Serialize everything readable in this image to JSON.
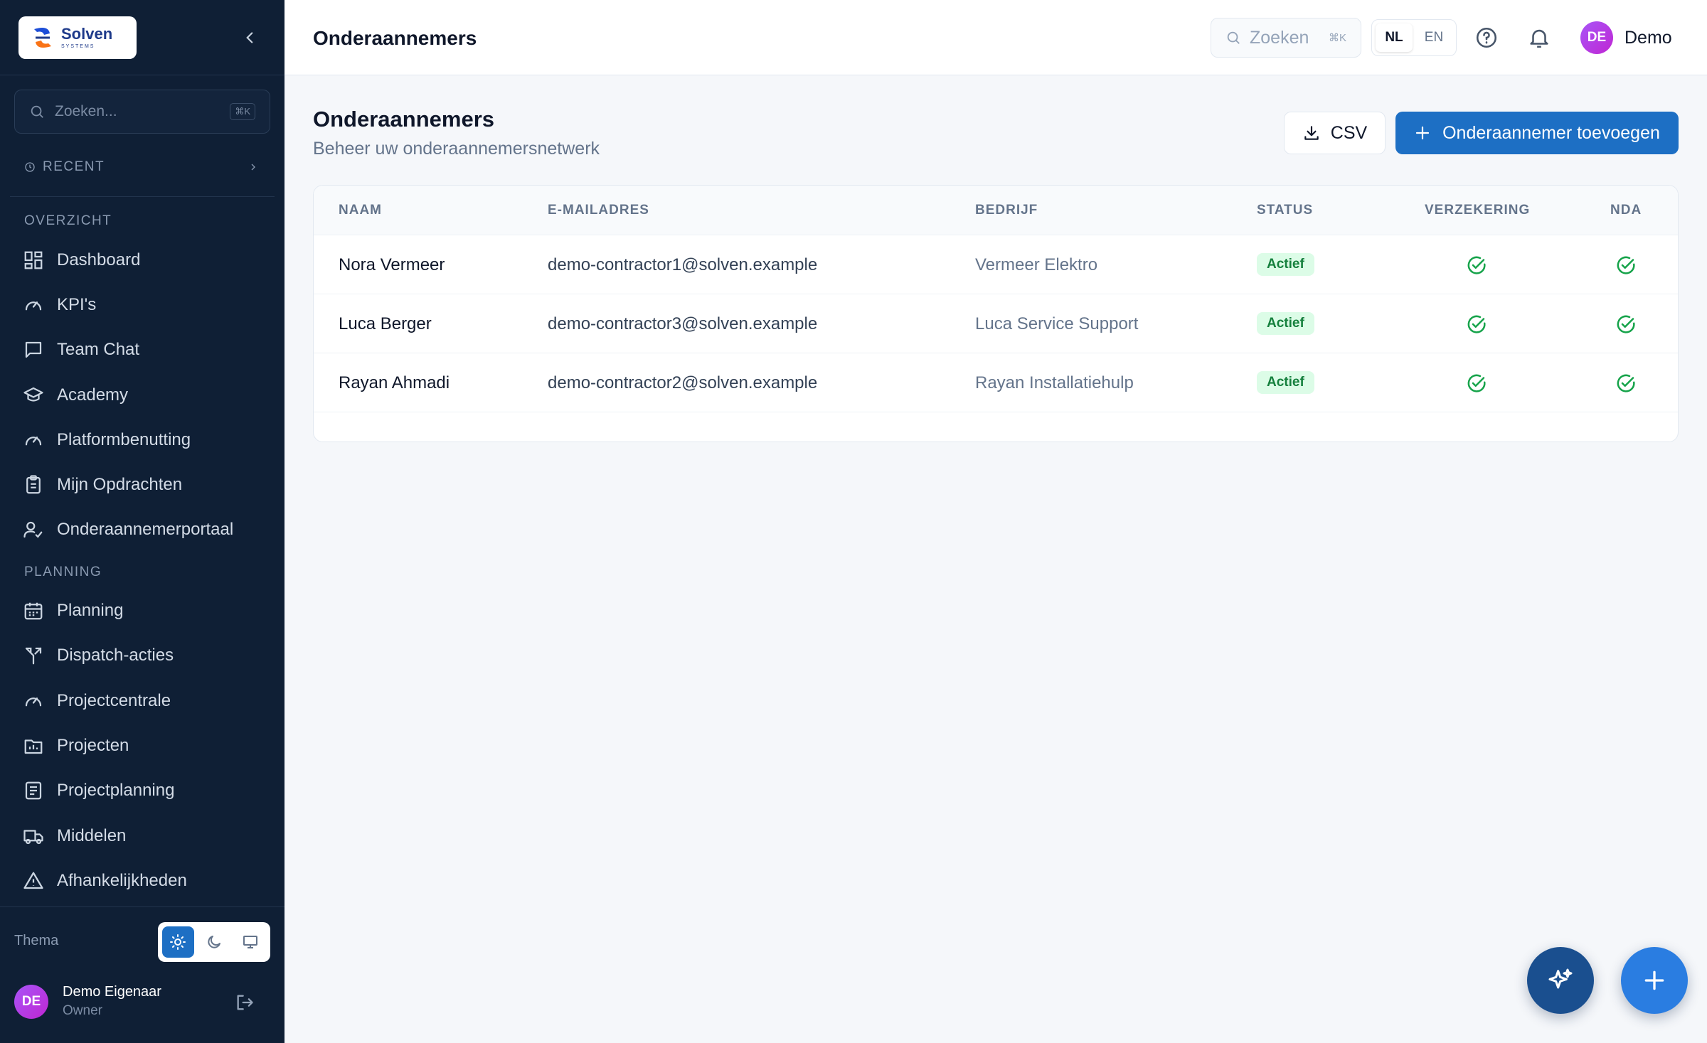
{
  "brand": {
    "name": "Solven",
    "tagline": "SYSTEMS"
  },
  "sidebar": {
    "search_placeholder": "Zoeken...",
    "search_shortcut": "⌘K",
    "recent_label": "RECENT",
    "sections": [
      {
        "label": "OVERZICHT",
        "items": [
          {
            "label": "Dashboard",
            "icon": "dashboard-icon"
          },
          {
            "label": "KPI's",
            "icon": "gauge-icon"
          },
          {
            "label": "Team Chat",
            "icon": "chat-icon"
          },
          {
            "label": "Academy",
            "icon": "graduation-cap-icon"
          },
          {
            "label": "Platformbenutting",
            "icon": "gauge-icon"
          },
          {
            "label": "Mijn Opdrachten",
            "icon": "clipboard-icon"
          },
          {
            "label": "Onderaannemerportaal",
            "icon": "user-check-icon"
          }
        ]
      },
      {
        "label": "PLANNING",
        "items": [
          {
            "label": "Planning",
            "icon": "calendar-icon"
          },
          {
            "label": "Dispatch-acties",
            "icon": "split-arrow-icon"
          },
          {
            "label": "Projectcentrale",
            "icon": "gauge-icon"
          },
          {
            "label": "Projecten",
            "icon": "folder-chart-icon"
          },
          {
            "label": "Projectplanning",
            "icon": "document-list-icon"
          },
          {
            "label": "Middelen",
            "icon": "truck-icon"
          },
          {
            "label": "Afhankelijkheden",
            "icon": "warning-triangle-icon"
          }
        ]
      }
    ],
    "theme_label": "Thema",
    "user": {
      "initials": "DE",
      "name": "Demo Eigenaar",
      "role": "Owner"
    }
  },
  "header": {
    "title": "Onderaannemers",
    "search_placeholder": "Zoeken",
    "search_shortcut": "⌘K",
    "languages": [
      "NL",
      "EN"
    ],
    "active_language": "NL",
    "user": {
      "initials": "DE",
      "name": "Demo"
    }
  },
  "main": {
    "title": "Onderaannemers",
    "subtitle": "Beheer uw onderaannemersnetwerk",
    "csv_label": "CSV",
    "add_label": "Onderaannemer toevoegen",
    "table": {
      "columns": [
        "NAAM",
        "E-MAILADRES",
        "BEDRIJF",
        "STATUS",
        "VERZEKERING",
        "NDA"
      ],
      "rows": [
        {
          "name": "Nora Vermeer",
          "email": "demo-contractor1@solven.example",
          "company": "Vermeer Elektro",
          "status": "Actief",
          "insurance": true,
          "nda": true
        },
        {
          "name": "Luca Berger",
          "email": "demo-contractor3@solven.example",
          "company": "Luca Service Support",
          "status": "Actief",
          "insurance": true,
          "nda": true
        },
        {
          "name": "Rayan Ahmadi",
          "email": "demo-contractor2@solven.example",
          "company": "Rayan Installatiehulp",
          "status": "Actief",
          "insurance": true,
          "nda": true
        }
      ]
    }
  },
  "colors": {
    "sidebar_bg": "#0f1f35",
    "primary": "#1d6fc4",
    "success": "#16a34a",
    "avatar": "#a855f7"
  }
}
